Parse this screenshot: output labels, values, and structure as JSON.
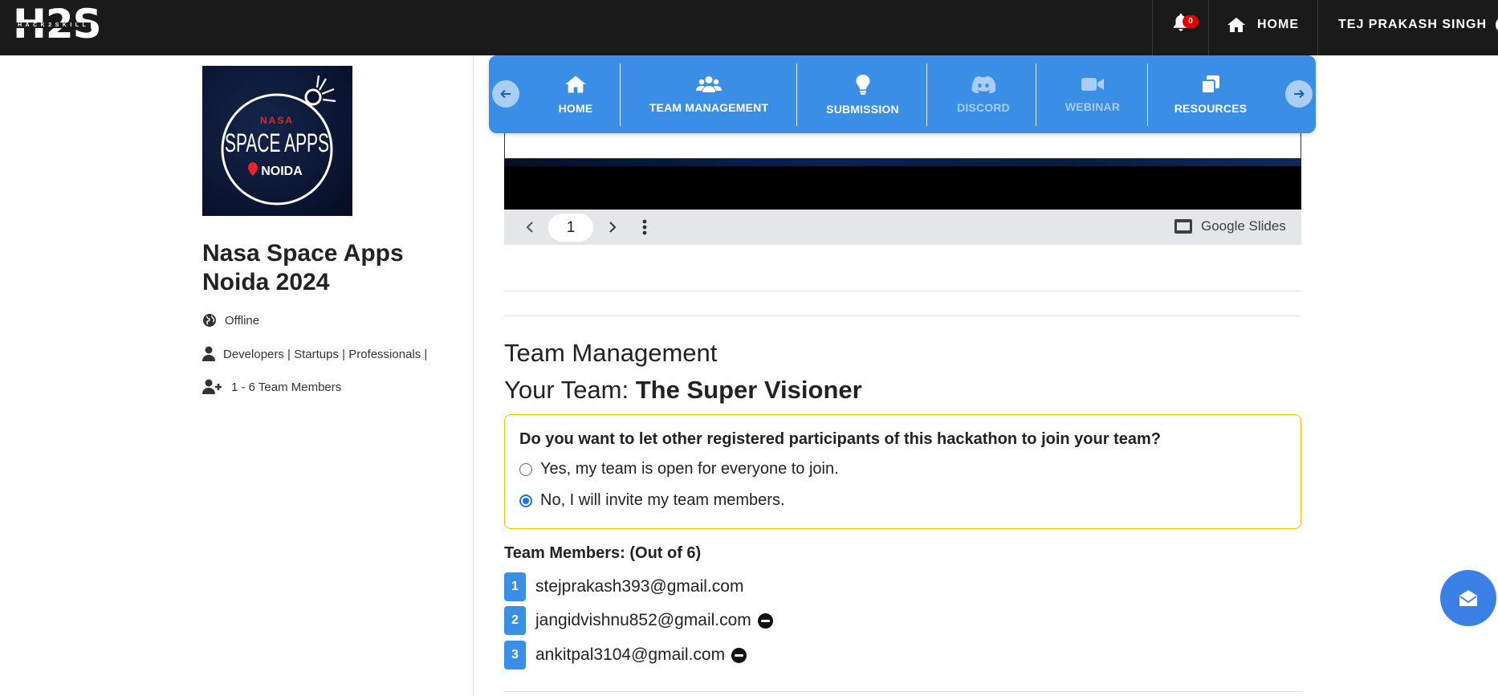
{
  "header": {
    "logo_text": "H2S",
    "logo_subtext": "HACK2SKILL",
    "notification_count": "0",
    "home_label": "HOME",
    "user_name": "TEJ PRAKASH SINGH"
  },
  "event": {
    "logo_top": "NASA",
    "logo_main": "SPACE APPS",
    "logo_city": "NOIDA",
    "title": "Nasa Space Apps Noida 2024",
    "mode": "Offline",
    "audience": "Developers | Startups | Professionals |",
    "team_size": "1 - 6 Team Members"
  },
  "tabs": [
    {
      "label": "HOME",
      "icon": "home-icon",
      "enabled": true
    },
    {
      "label": "TEAM MANAGEMENT",
      "icon": "users-icon",
      "enabled": true
    },
    {
      "label": "SUBMISSION",
      "icon": "lightbulb-icon",
      "enabled": true
    },
    {
      "label": "DISCORD",
      "icon": "discord-icon",
      "enabled": false
    },
    {
      "label": "WEBINAR",
      "icon": "video-icon",
      "enabled": false
    },
    {
      "label": "RESOURCES",
      "icon": "copy-icon",
      "enabled": true
    }
  ],
  "slides": {
    "page": "1",
    "brand": "Google Slides"
  },
  "team_management": {
    "heading": "Team Management",
    "team_prefix": "Your Team:",
    "team_name": "The Super Visioner",
    "join_question": "Do you want to let other registered participants of this hackathon to join your team?",
    "options": [
      {
        "label": "Yes, my team is open for everyone to join.",
        "checked": false
      },
      {
        "label": "No, I will invite my team members.",
        "checked": true
      }
    ],
    "members_title": "Team Members: (Out of 6)",
    "members": [
      {
        "num": "1",
        "email": "stejprakash393@gmail.com",
        "removable": false
      },
      {
        "num": "2",
        "email": "jangidvishnu852@gmail.com",
        "removable": true
      },
      {
        "num": "3",
        "email": "ankitpal3104@gmail.com",
        "removable": true
      }
    ]
  },
  "colors": {
    "topbar": "#1a1a1a",
    "tab_blue": "#3a8ee6",
    "badge_red": "#e60000",
    "box_border": "#f2c200"
  }
}
